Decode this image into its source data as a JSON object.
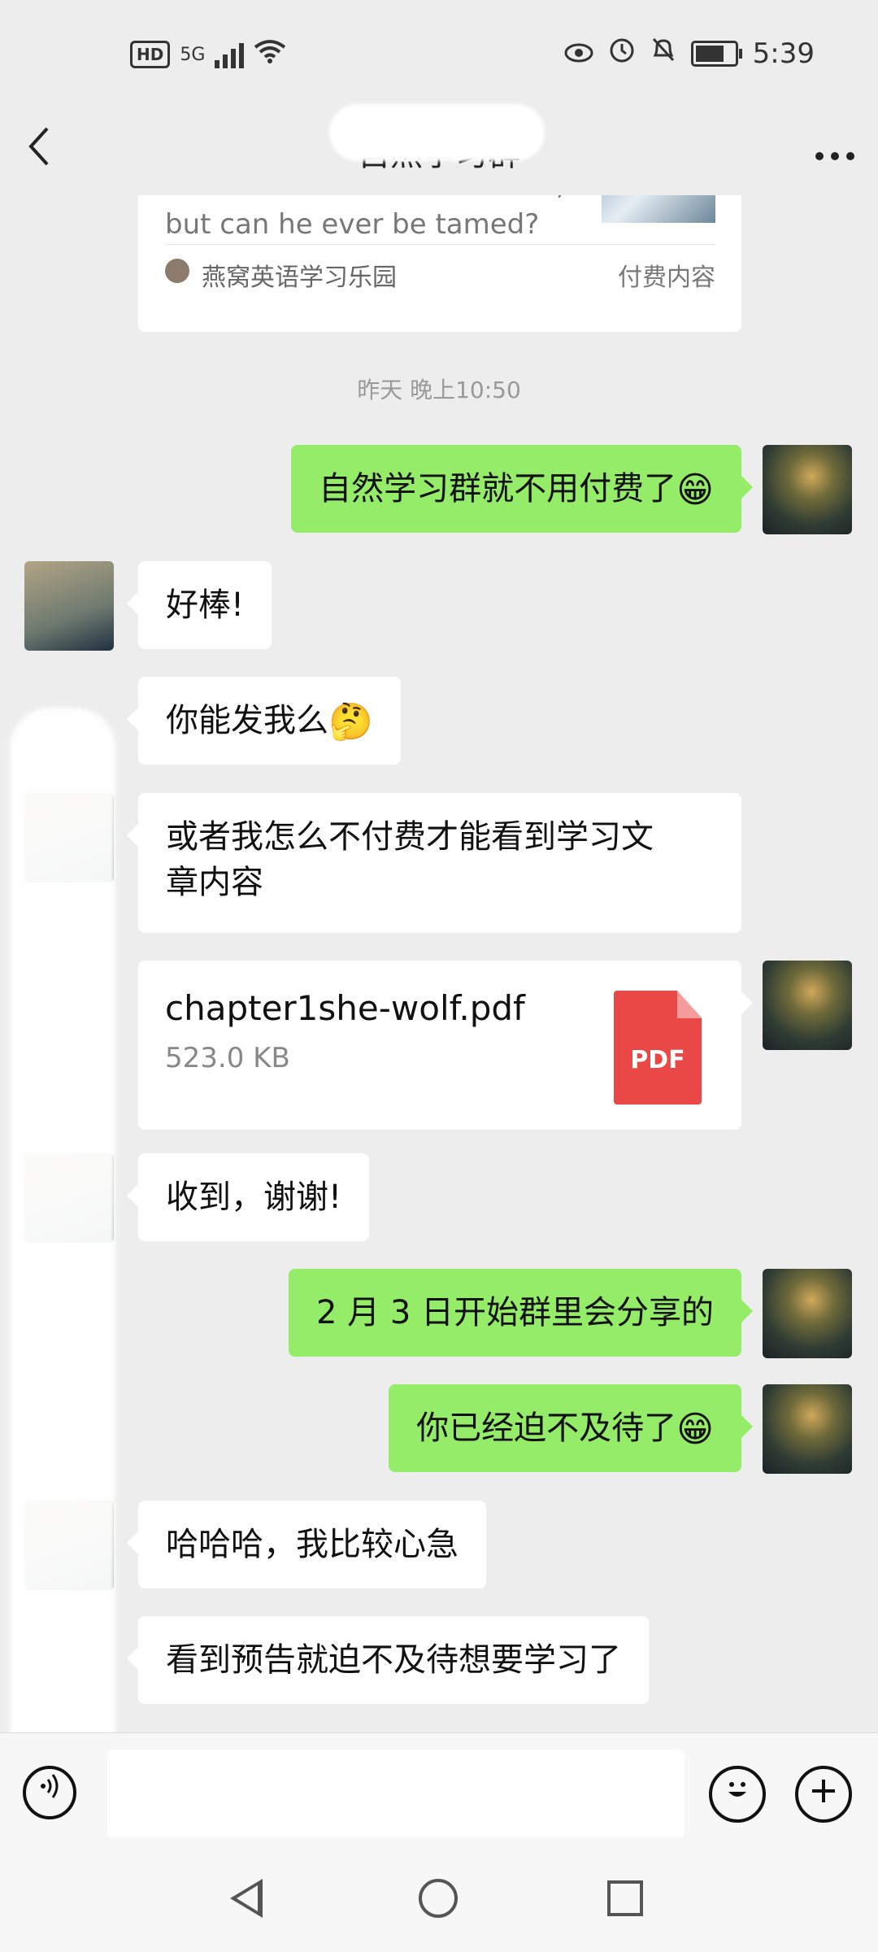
{
  "status_bar": {
    "hd": "HD",
    "network": "5G",
    "time": "5:39",
    "battery_level": 0.85
  },
  "header": {
    "title": "自然学习群"
  },
  "shared_card": {
    "desc_line1": "wilderness of North America,",
    "desc_line2": "but can he ever be tamed?",
    "source": "燕窝英语学习乐园",
    "tag": "付费内容"
  },
  "timestamp": "昨天 晚上10:50",
  "messages": {
    "m1": "自然学习群就不用付费了",
    "m2": "好棒!",
    "m3": "你能发我么",
    "m4_line1": "或者我怎么不付费才能看到学习文",
    "m4_line2": "章内容",
    "m6": "收到，谢谢!",
    "m7": "2 月 3 日开始群里会分享的",
    "m8": "你已经迫不及待了",
    "m9": "哈哈哈，我比较心急",
    "m10": "看到预告就迫不及待想要学习了"
  },
  "file": {
    "name": "chapter1she-wolf.pdf",
    "size": "523.0 KB",
    "type_label": "PDF"
  },
  "emojis": {
    "grin": "😁",
    "thinking": "🤔"
  },
  "input": {
    "value": "",
    "placeholder": ""
  },
  "icons": {
    "back": "back-icon",
    "more": "more-icon",
    "voice": "voice-icon",
    "emoji": "emoji-icon",
    "plus": "plus-icon"
  }
}
